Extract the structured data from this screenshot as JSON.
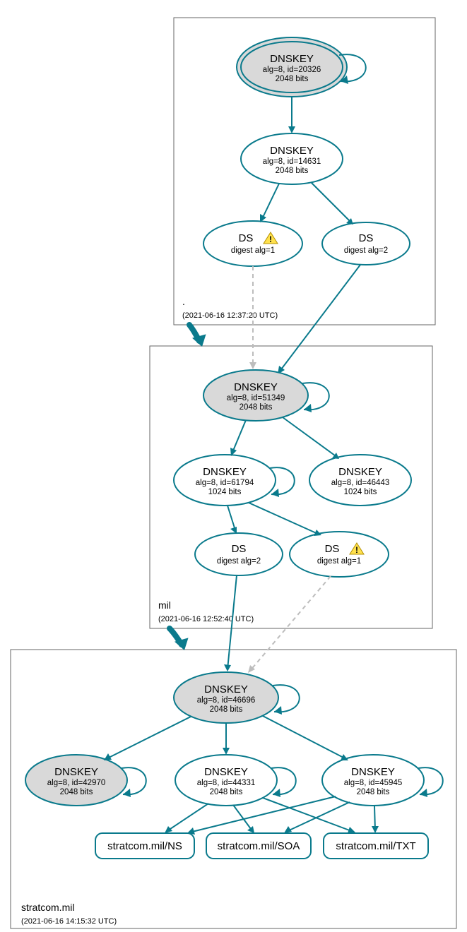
{
  "colors": {
    "stroke": "#0a7a8c",
    "node_grey": "#d9d9d9"
  },
  "zones": {
    "root": {
      "label": ".",
      "timestamp": "(2021-06-16 12:37:20 UTC)"
    },
    "mil": {
      "label": "mil",
      "timestamp": "(2021-06-16 12:52:40 UTC)"
    },
    "stratcom": {
      "label": "stratcom.mil",
      "timestamp": "(2021-06-16 14:15:32 UTC)"
    }
  },
  "nodes": {
    "root_dnskey_20326": {
      "title": "DNSKEY",
      "line2": "alg=8, id=20326",
      "line3": "2048 bits"
    },
    "root_dnskey_14631": {
      "title": "DNSKEY",
      "line2": "alg=8, id=14631",
      "line3": "2048 bits"
    },
    "root_ds1": {
      "title": "DS",
      "line2": "digest alg=1"
    },
    "root_ds2": {
      "title": "DS",
      "line2": "digest alg=2"
    },
    "mil_dnskey_51349": {
      "title": "DNSKEY",
      "line2": "alg=8, id=51349",
      "line3": "2048 bits"
    },
    "mil_dnskey_61794": {
      "title": "DNSKEY",
      "line2": "alg=8, id=61794",
      "line3": "1024 bits"
    },
    "mil_dnskey_46443": {
      "title": "DNSKEY",
      "line2": "alg=8, id=46443",
      "line3": "1024 bits"
    },
    "mil_ds2": {
      "title": "DS",
      "line2": "digest alg=2"
    },
    "mil_ds1": {
      "title": "DS",
      "line2": "digest alg=1"
    },
    "str_dnskey_46696": {
      "title": "DNSKEY",
      "line2": "alg=8, id=46696",
      "line3": "2048 bits"
    },
    "str_dnskey_42970": {
      "title": "DNSKEY",
      "line2": "alg=8, id=42970",
      "line3": "2048 bits"
    },
    "str_dnskey_44331": {
      "title": "DNSKEY",
      "line2": "alg=8, id=44331",
      "line3": "2048 bits"
    },
    "str_dnskey_45945": {
      "title": "DNSKEY",
      "line2": "alg=8, id=45945",
      "line3": "2048 bits"
    },
    "rr_ns": "stratcom.mil/NS",
    "rr_soa": "stratcom.mil/SOA",
    "rr_txt": "stratcom.mil/TXT"
  }
}
